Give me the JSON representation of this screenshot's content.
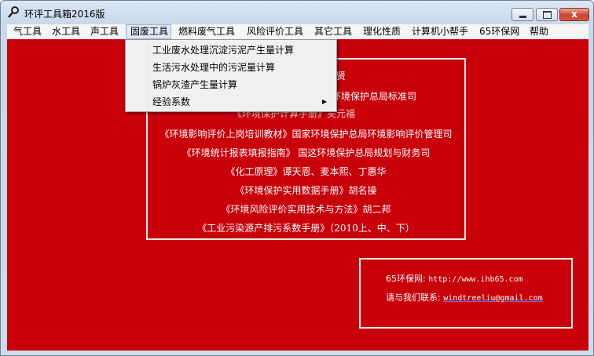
{
  "window": {
    "title": "环评工具箱2016版"
  },
  "title_buttons": {
    "close_label": "x"
  },
  "menu": [
    {
      "label": "气工具"
    },
    {
      "label": "水工具"
    },
    {
      "label": "声工具"
    },
    {
      "label": "固废工具"
    },
    {
      "label": "燃料废气工具"
    },
    {
      "label": "风险评价工具"
    },
    {
      "label": "其它工具"
    },
    {
      "label": "理化性质"
    },
    {
      "label": "计算机小帮手"
    },
    {
      "label": "65环保网"
    },
    {
      "label": "帮助"
    }
  ],
  "dropdown": {
    "items": [
      {
        "label": "工业废水处理沉淀污泥产生量计算"
      },
      {
        "label": "生活污水处理中的污泥量计算"
      },
      {
        "label": "锅炉灰渣产生量计算"
      },
      {
        "label": "经验系数"
      }
    ],
    "submenu_arrow": "▶"
  },
  "references": [
    "贤",
    "家环境保护总局标准司",
    "《环境保护计算手册》吴元福",
    "《环境影响评价上岗培训教材》国家环境保护总局环境影响评价管理司",
    "《环境统计报表填报指南》  国这环境保护总局规划与财务司",
    "《化工原理》谭天恩、麦本熙、丁惠华",
    "《环境保护实用数据手册》胡名操",
    "《环境风险评价实用技术与方法》胡二邦",
    "《工业污染源产排污系数手册》（2010上、中、下）"
  ],
  "contact": {
    "site_label": "65环保网:",
    "site_url": "http://www.ihb65.com",
    "email_label": "请与我们联系:",
    "email": "windtreeliu@gmail.com"
  },
  "colors": {
    "client_bg": "#c8000a",
    "text": "#ffffff"
  }
}
